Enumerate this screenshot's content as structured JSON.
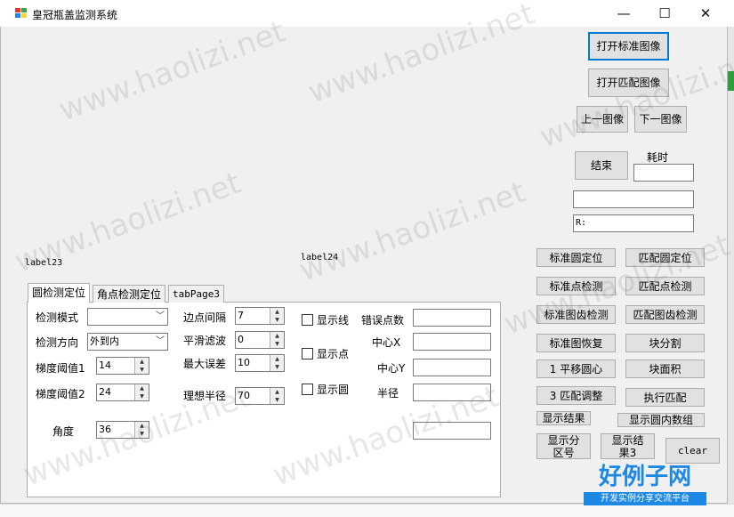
{
  "window": {
    "title": "皇冠瓶盖监测系统",
    "controls": {
      "minimize": "—",
      "maximize": "☐",
      "close": "✕"
    }
  },
  "top_buttons": {
    "open_standard": "打开标准图像",
    "open_match": "打开匹配图像",
    "prev_image": "上一图像",
    "next_image": "下一图像",
    "end": "结束",
    "elapsed_label": "耗时",
    "r_field_value": "R:"
  },
  "labels": {
    "label23": "label23",
    "label24": "label24"
  },
  "tabs": [
    {
      "label": "圆检测定位"
    },
    {
      "label": "角点检测定位"
    },
    {
      "label": "tabPage3"
    }
  ],
  "form": {
    "detect_mode_label": "检测模式",
    "detect_mode_value": "",
    "detect_dir_label": "检测方向",
    "detect_dir_value": "外到内",
    "grad_th1_label": "梯度阈值1",
    "grad_th1_value": "14",
    "grad_th2_label": "梯度阈值2",
    "grad_th2_value": "24",
    "angle_label": "角度",
    "angle_value": "36",
    "edge_spacing_label": "边点间隔",
    "edge_spacing_value": "7",
    "smooth_label": "平滑滤波",
    "smooth_value": "0",
    "max_error_label": "最大误差",
    "max_error_value": "10",
    "ideal_radius_label": "理想半径",
    "ideal_radius_value": "70",
    "show_line_label": "显示线",
    "show_point_label": "显示点",
    "show_circle_label": "显示圆",
    "error_count_label": "错误点数",
    "center_x_label": "中心X",
    "center_y_label": "中心Y",
    "radius_label": "半径"
  },
  "right_buttons": {
    "std_circle_locate": "标准圆定位",
    "match_circle_locate": "匹配圆定位",
    "std_point_detect": "标准点检测",
    "match_point_detect": "匹配点检测",
    "std_tooth_detect": "标准图齿检测",
    "match_tooth_detect": "匹配图齿检测",
    "std_restore": "标准图恢复",
    "block_split": "块分割",
    "translate_circle": "1 平移圆心",
    "block_area": "块面积",
    "match_adjust": "3 匹配调整",
    "run_match": "执行匹配",
    "show_result": "显示结果",
    "show_circle_array": "显示圆内数组",
    "show_zone_num": "显示分区号",
    "show_result3": "显示结果3",
    "clear": "clear"
  },
  "watermark": {
    "text": "www.haolizi.net",
    "logo_main": "好例子网",
    "logo_sub": "开发实例分享交流平台"
  },
  "colors": {
    "accent": "#0078d7",
    "logo_blue": "#1e88e5"
  }
}
